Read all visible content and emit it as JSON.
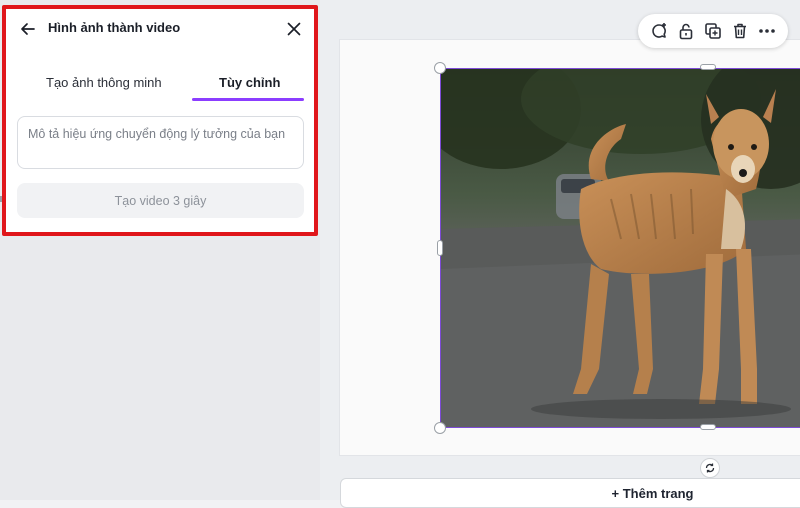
{
  "panel": {
    "title": "Hình ảnh thành video",
    "tabs": [
      {
        "label": "Tạo ảnh thông minh",
        "active": false
      },
      {
        "label": "Tùy chỉnh",
        "active": true
      }
    ],
    "prompt_placeholder": "Mô tả hiệu ứng chuyển động lý tưởng của bạn",
    "generate_label": "Tạo video 3 giây",
    "highlight_color": "#e0161b",
    "accent_color": "#8b3dff"
  },
  "toolbar": {
    "icons": [
      "comment-add-icon",
      "lock-icon",
      "duplicate-icon",
      "trash-icon",
      "more-icon"
    ]
  },
  "canvas": {
    "add_page_label": "+ Thêm trang",
    "selection_color": "#7d4bd6"
  }
}
